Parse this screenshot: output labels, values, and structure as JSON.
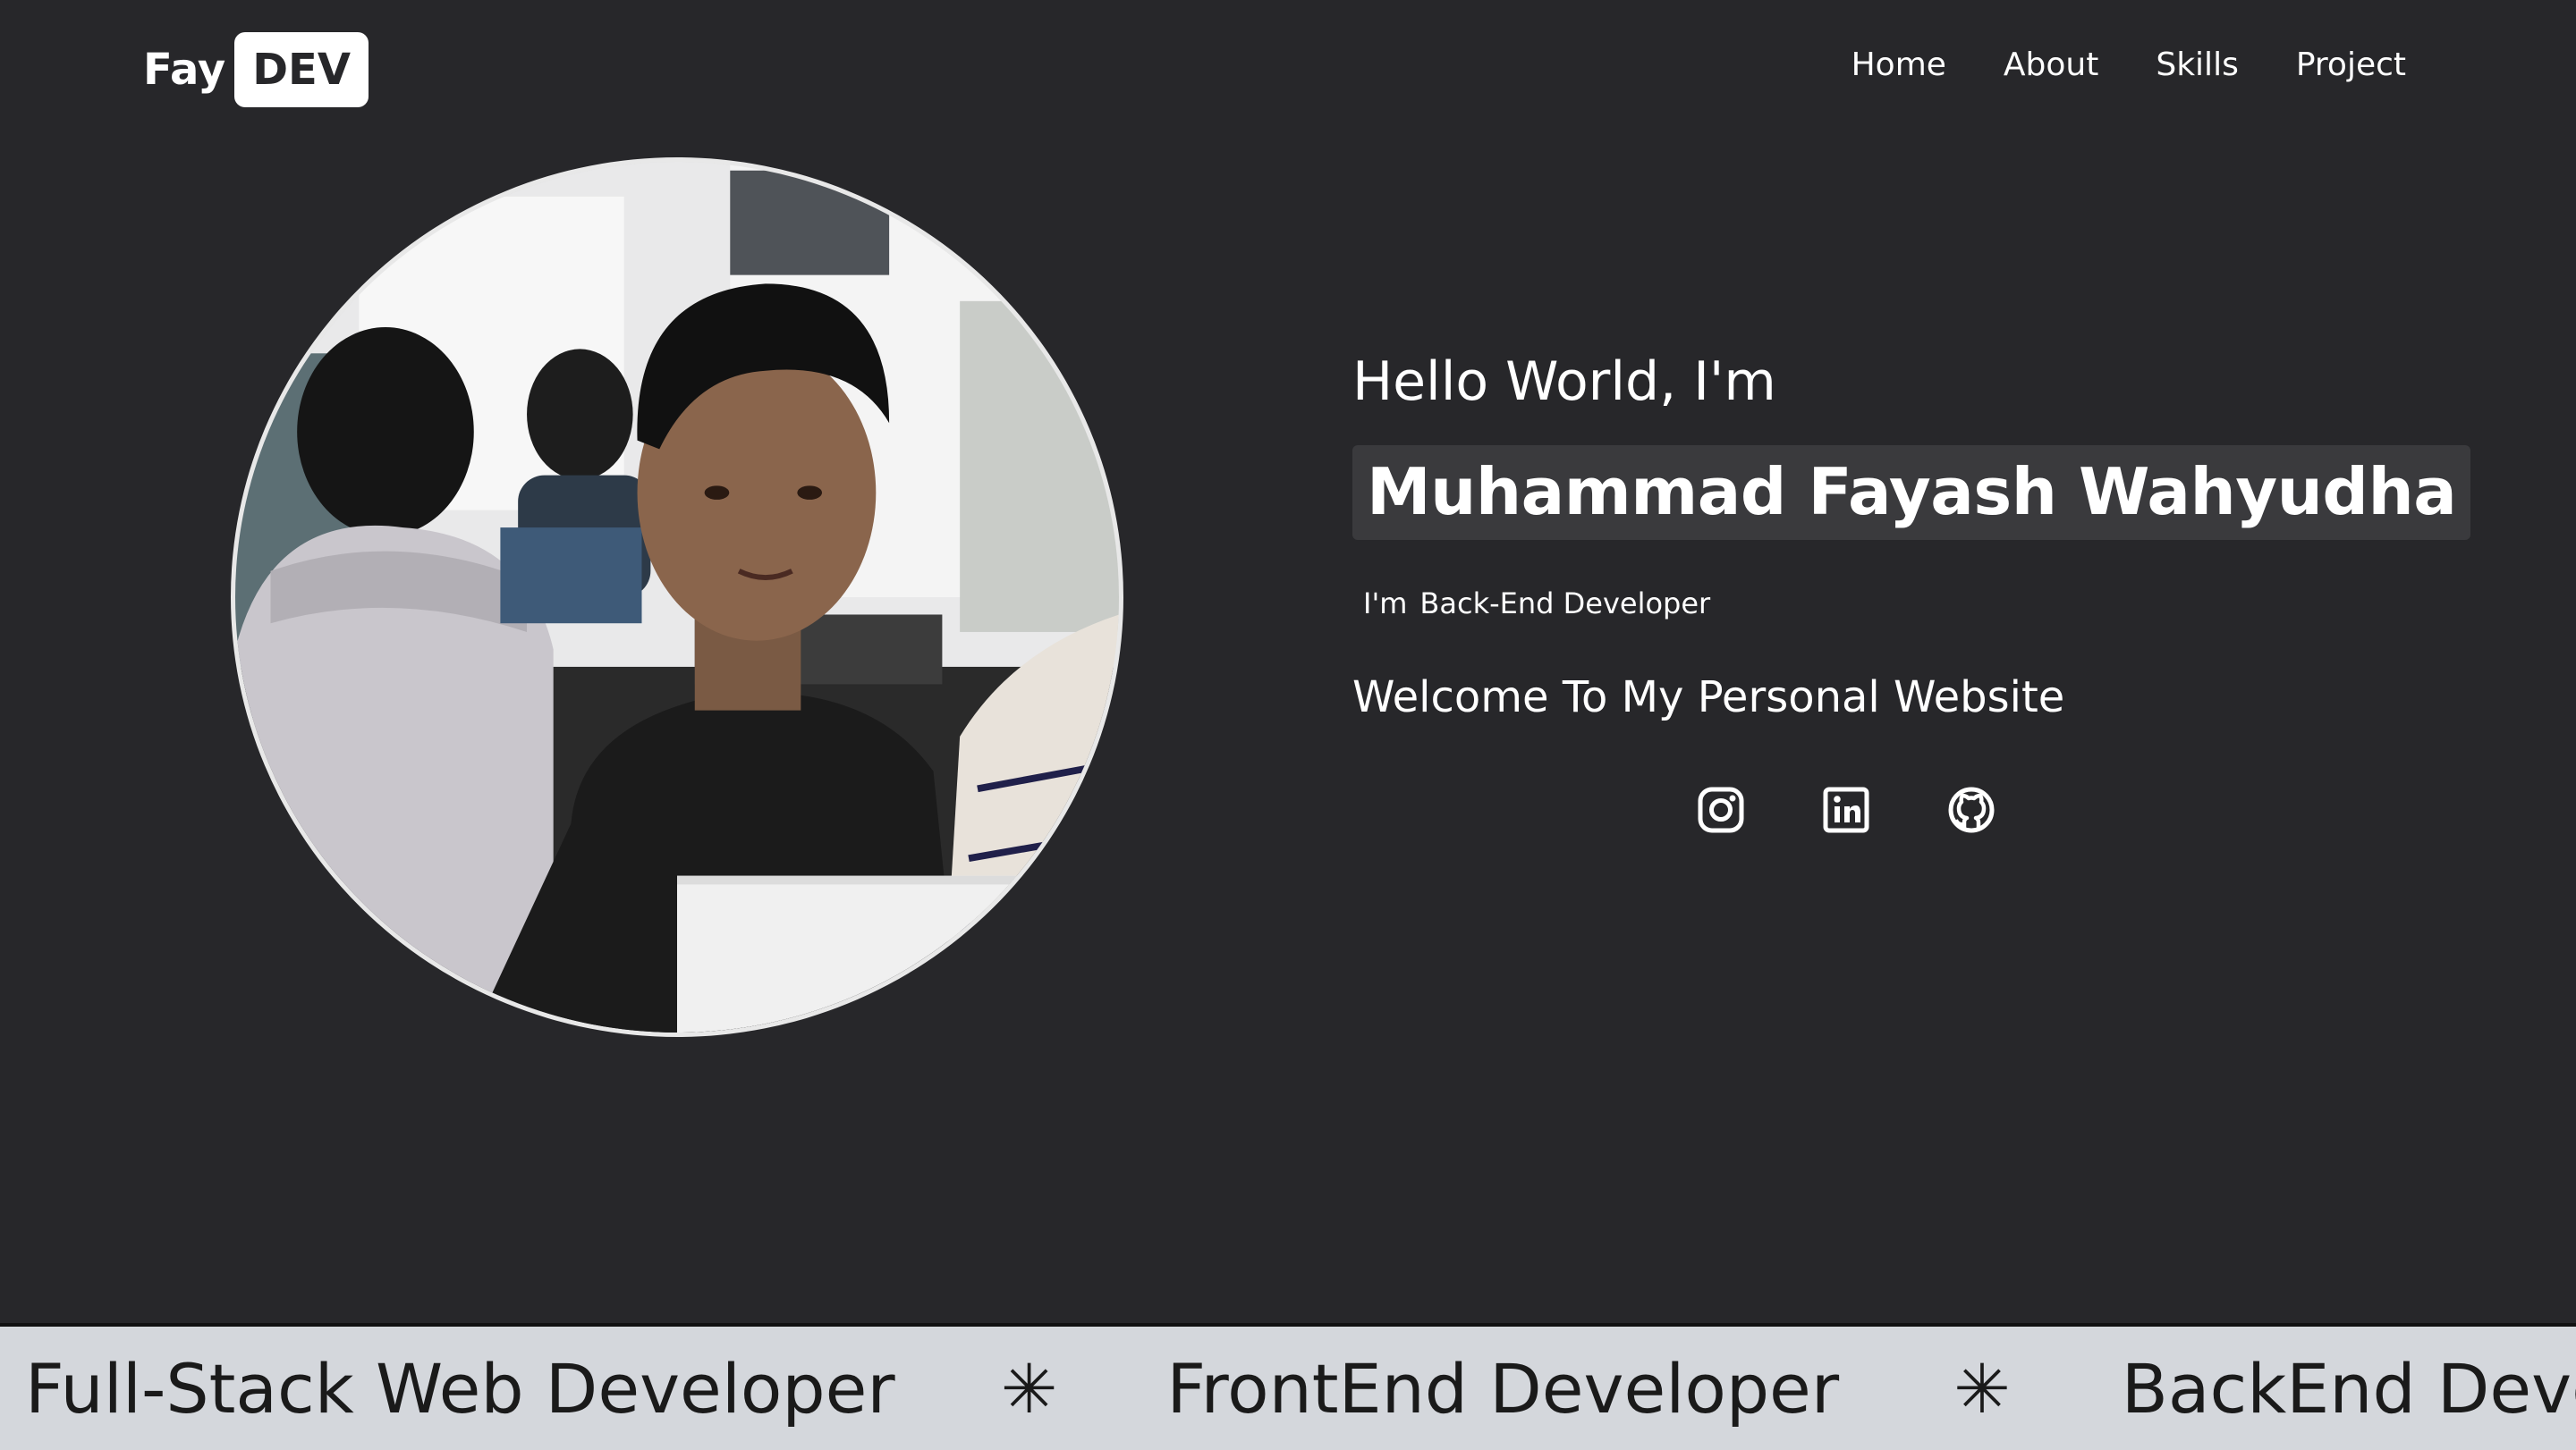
{
  "brand": {
    "name": "Fay",
    "badge": "DEV"
  },
  "nav": {
    "items": [
      {
        "label": "Home"
      },
      {
        "label": "About"
      },
      {
        "label": "Skills"
      },
      {
        "label": "Project"
      }
    ]
  },
  "hero": {
    "greeting": "Hello World, I'm",
    "name": "Muhammad Fayash Wahyudha",
    "role_prefix": "I'm",
    "role": "Back-End Developer",
    "welcome": "Welcome To My Personal Website"
  },
  "socials": [
    {
      "icon": "instagram-icon"
    },
    {
      "icon": "linkedin-icon"
    },
    {
      "icon": "github-icon"
    }
  ],
  "marquee": {
    "items": [
      "Full-Stack Web Developer",
      "FrontEnd Developer",
      "BackEnd Developer"
    ],
    "separator": "✳"
  },
  "colors": {
    "background": "#27272a",
    "name_highlight": "#3a3a3d",
    "marquee_bg": "#d4d7dc",
    "text": "#ffffff"
  }
}
